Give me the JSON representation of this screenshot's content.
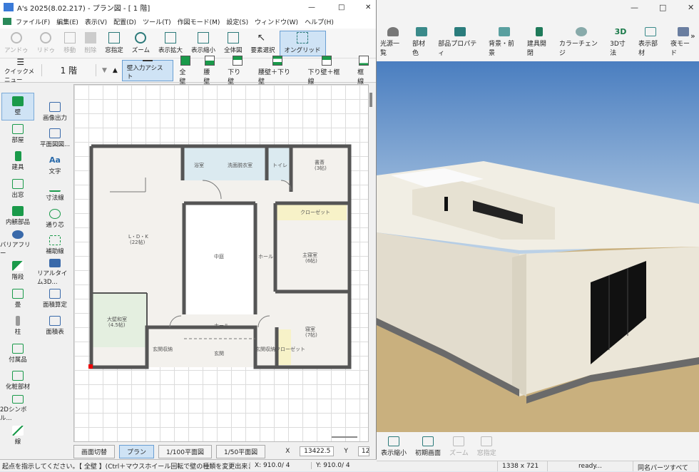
{
  "plan_window": {
    "title": "A's 2025(8.02.217) - プラン図 - [ 1 階]",
    "menus": [
      "ファイル(F)",
      "編集(E)",
      "表示(V)",
      "配置(D)",
      "ツール(T)",
      "作図モード(M)",
      "設定(S)",
      "ウィンドウ(W)",
      "ヘルプ(H)"
    ],
    "toolbar": [
      {
        "label": "アンドゥ",
        "icon": "undo-icon",
        "dim": true
      },
      {
        "label": "リドゥ",
        "icon": "redo-icon",
        "dim": true
      },
      {
        "label": "移動",
        "icon": "move-icon",
        "dim": true
      },
      {
        "label": "削除",
        "icon": "eraser-icon",
        "dim": true
      },
      {
        "label": "窓指定",
        "icon": "window-select-icon",
        "dim": false
      },
      {
        "label": "ズーム",
        "icon": "zoom-icon",
        "dim": false
      },
      {
        "label": "表示拡大",
        "icon": "zoom-in-icon",
        "dim": false
      },
      {
        "label": "表示縮小",
        "icon": "zoom-out-icon",
        "dim": false
      },
      {
        "label": "全体図",
        "icon": "fit-all-icon",
        "dim": false
      },
      {
        "label": "要素選択",
        "icon": "cursor-icon",
        "dim": false
      },
      {
        "label": "オングリッド",
        "icon": "grid-snap-icon",
        "dim": false
      }
    ],
    "toolbar2": {
      "quick_menu": "クイックメニュー",
      "floor": "1 階",
      "wall_assist": "壁入力アシスト",
      "wall_types": [
        "全壁",
        "腰壁",
        "下り壁",
        "腰壁＋下り壁",
        "下り壁＋框線",
        "框線"
      ]
    },
    "sidebar_left": [
      "壁",
      "部屋",
      "建具",
      "出窓",
      "内観部品",
      "バリアフリー",
      "階段",
      "畳",
      "柱",
      "付属品",
      "化粧部材",
      "2Dシンボル...",
      "線"
    ],
    "sidebar_right": [
      "画像出力",
      "平面図図...",
      "文字",
      "寸法線",
      "通り芯",
      "補助線",
      "リアルタイム3D...",
      "面積算定",
      "面積表"
    ],
    "rooms": {
      "bath": "浴室",
      "washroom": "洗面脱衣室",
      "toilet": "トイレ",
      "study": "書斎",
      "study_size": "(3帖)",
      "closet": "クローゼット",
      "ldk": "L・D・K",
      "ldk_size": "(22帖)",
      "courtyard": "中庭",
      "hall": "ホール",
      "master": "主寝室",
      "master_size": "(6帖)",
      "japanese": "大壁和室",
      "japanese_size": "(4.5帖)",
      "hall2": "ホール",
      "bedroom": "寝室",
      "bedroom_size": "(7帖)",
      "entrance_storage": "玄関収納",
      "entrance": "玄関",
      "entrance_closet": "玄関収納クローゼット"
    },
    "tabs": [
      "画面切替",
      "プラン",
      "1/100平面図",
      "1/50平面図"
    ],
    "coords": {
      "x_label": "X",
      "x_value": "13422.5",
      "y_label": "Y",
      "y_value": "12"
    },
    "status": {
      "message": "起点を指示してください。【 全壁 】(Ctrl＋マウスホイール回転で壁の種類を変更出来ます。)",
      "x": "X: 910.0/ 4",
      "y": "Y: 910.0/ 4"
    }
  },
  "view3d_window": {
    "toolbar": [
      {
        "label": "光源一覧",
        "icon": "light-icon"
      },
      {
        "label": "部材色",
        "icon": "material-color-icon"
      },
      {
        "label": "部品プロパティ",
        "icon": "part-property-icon"
      },
      {
        "label": "背景・前景",
        "icon": "background-icon"
      },
      {
        "label": "建具開閉",
        "icon": "door-open-icon"
      },
      {
        "label": "カラーチェンジ",
        "icon": "color-change-icon"
      },
      {
        "label": "3D寸法",
        "icon": "3d-dimension-icon"
      },
      {
        "label": "表示部材",
        "icon": "display-parts-icon"
      },
      {
        "label": "夜モード",
        "icon": "night-mode-icon"
      }
    ],
    "bottom_buttons": [
      {
        "label": "表示縮小",
        "dim": false
      },
      {
        "label": "初期画面",
        "dim": false
      },
      {
        "label": "ズーム",
        "dim": true
      },
      {
        "label": "窓指定",
        "dim": true
      }
    ],
    "status": {
      "size": "1338 x 721",
      "state": "ready...",
      "same_name": "同名パーツすべて"
    },
    "colors": {
      "sky_top": "#4a7ec0",
      "sky_bottom": "#c9dbeb",
      "ground": "#c9b07e",
      "wall": "#e8e3d6"
    }
  }
}
